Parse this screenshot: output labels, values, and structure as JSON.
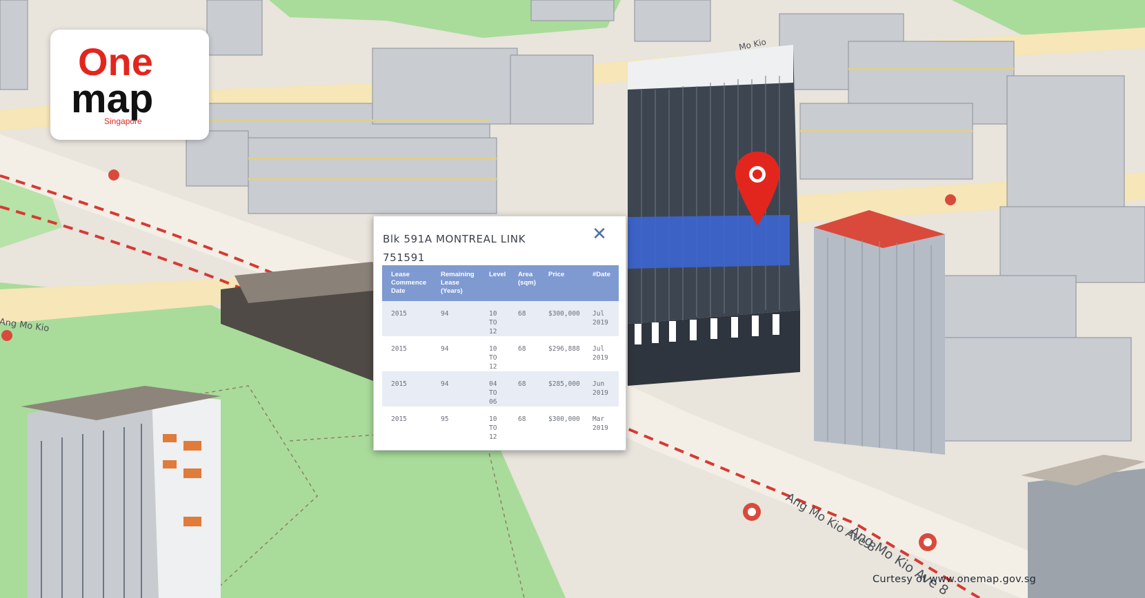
{
  "app": {
    "logo_text_one": "One",
    "logo_text_map": "map",
    "logo_text_country": "Singapore"
  },
  "map": {
    "road_labels": [
      "Ang Mo Kio Ave 8",
      "Ang Mo Kio Ave 8",
      "Ang Mo Kio",
      "Mo Kio"
    ],
    "colors": {
      "ground": "#e9e4dc",
      "park": "#a9dc9a",
      "highlight_floor": "#3b67d8",
      "pin": "#e3261d",
      "roof_red": "#d94a3c",
      "dashed_line": "#d63a33"
    },
    "marker_icon": "location-pin-icon"
  },
  "popup": {
    "title_line1": "Blk 591A MONTREAL LINK",
    "title_line2": "751591",
    "close_icon": "close-icon",
    "columns": [
      "Lease Commence Date",
      "Remaining Lease (Years)",
      "Level",
      "Area (sqm)",
      "Price",
      "#Date"
    ],
    "rows": [
      {
        "lease": "2015",
        "remaining": "94",
        "level": "10 TO 12",
        "area": "68",
        "price": "$300,000",
        "date": "Jul 2019"
      },
      {
        "lease": "2015",
        "remaining": "94",
        "level": "10 TO 12",
        "area": "68",
        "price": "$296,888",
        "date": "Jul 2019"
      },
      {
        "lease": "2015",
        "remaining": "94",
        "level": "04 TO 06",
        "area": "68",
        "price": "$285,000",
        "date": "Jun 2019"
      },
      {
        "lease": "2015",
        "remaining": "95",
        "level": "10 TO 12",
        "area": "68",
        "price": "$300,000",
        "date": "Mar 2019"
      }
    ]
  },
  "footer": {
    "credit": "Curtesy of  www.onemap.gov.sg"
  }
}
